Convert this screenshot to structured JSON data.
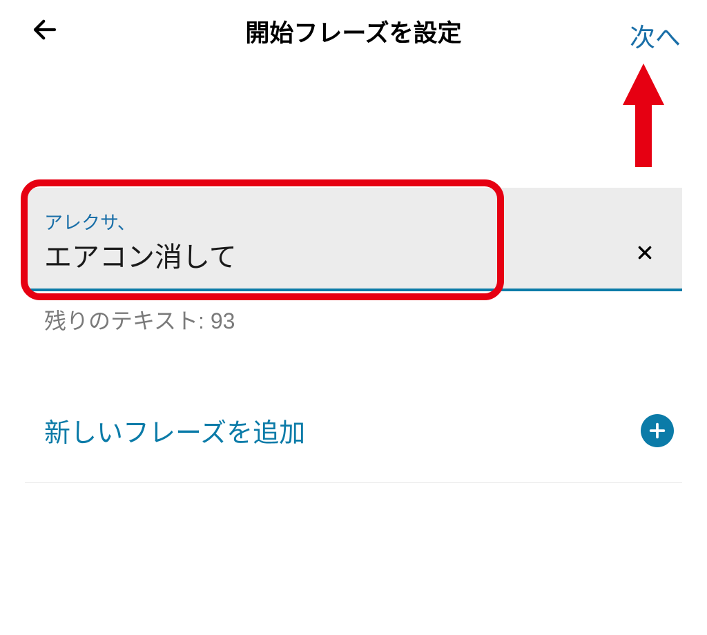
{
  "header": {
    "title": "開始フレーズを設定",
    "next_label": "次へ"
  },
  "phrase": {
    "wake_word": "アレクサ、",
    "value": "エアコン消して"
  },
  "remaining": "残りのテキスト: 93",
  "add_phrase_label": "新しいフレーズを追加",
  "colors": {
    "accent": "#0b7ba8",
    "annotation": "#e60012"
  }
}
